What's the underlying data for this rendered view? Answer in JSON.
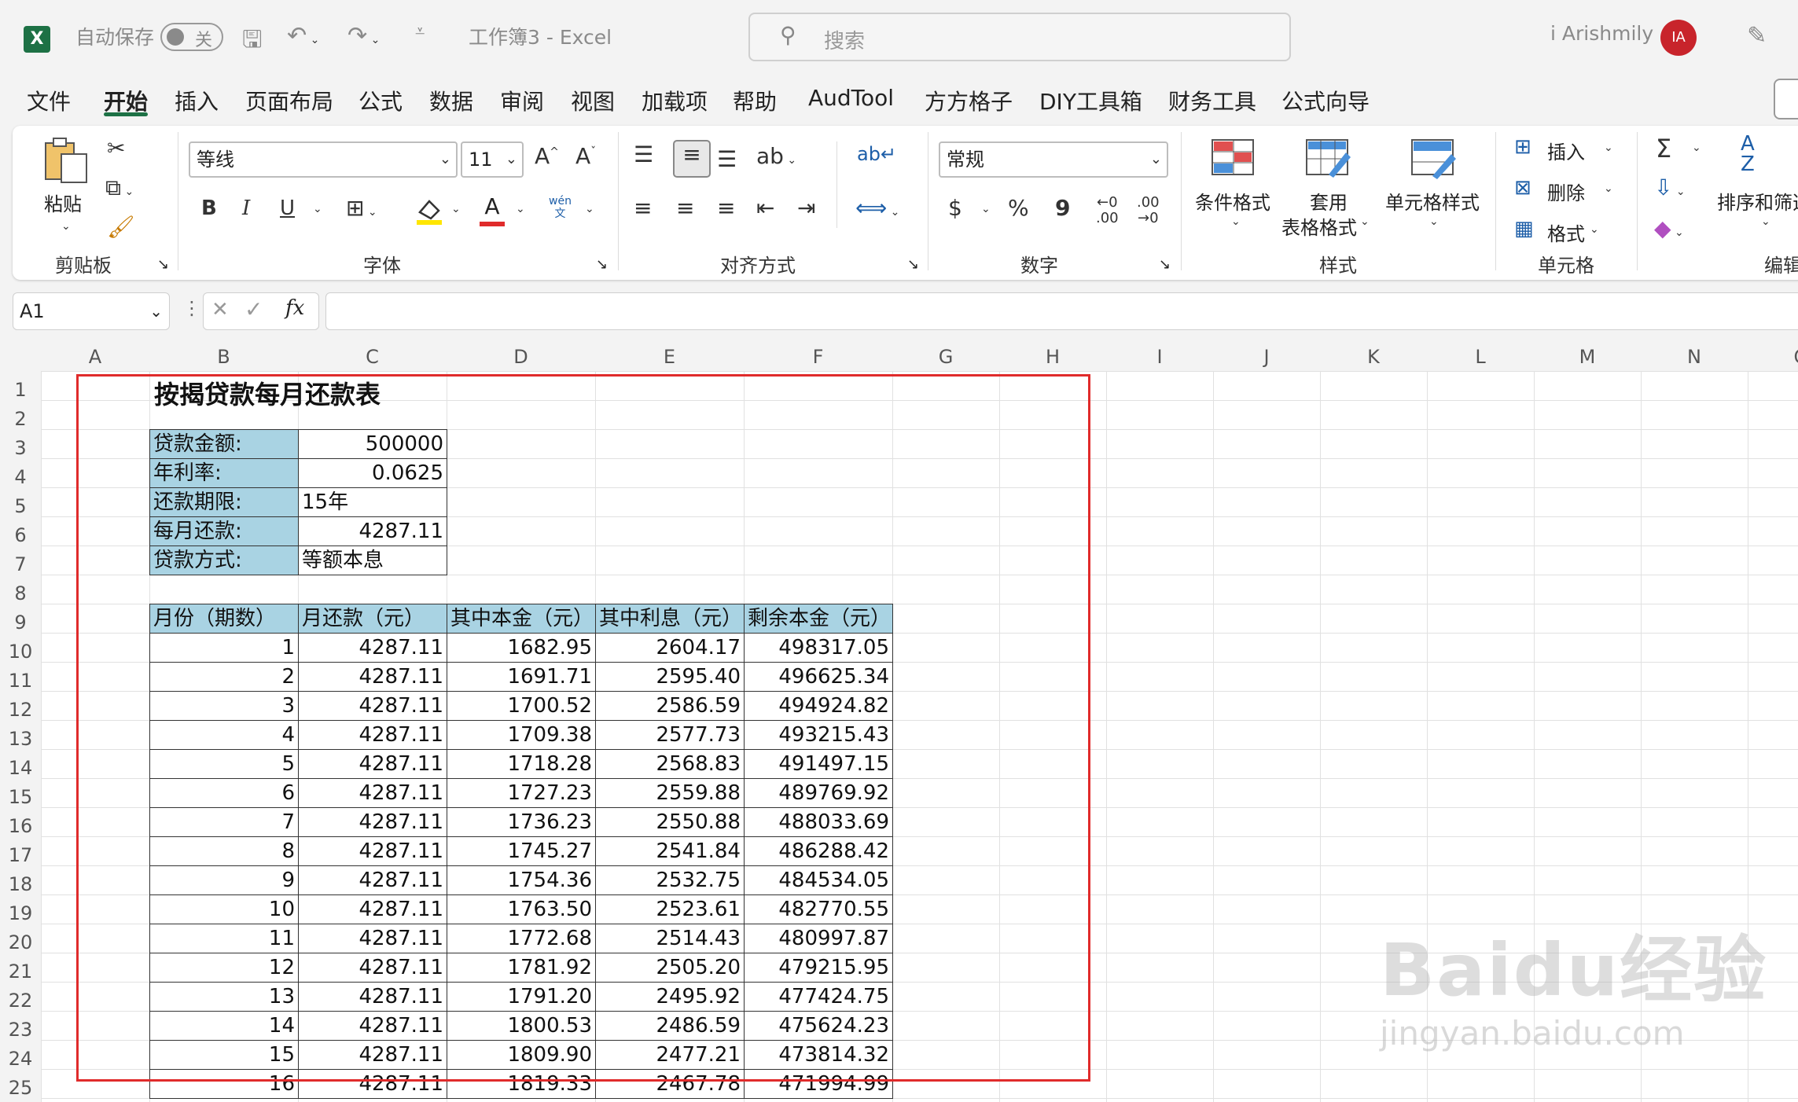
{
  "titlebar": {
    "autosave_label": "自动保存",
    "autosave_state": "关",
    "doc_title": "工作簿3  -  Excel",
    "search_placeholder": "搜索",
    "user_name": "i Arishmily",
    "user_initials": "IA"
  },
  "menu": {
    "tabs": [
      "文件",
      "开始",
      "插入",
      "页面布局",
      "公式",
      "数据",
      "审阅",
      "视图",
      "加载项",
      "帮助",
      "AudTool",
      "方方格子",
      "DIY工具箱",
      "财务工具",
      "公式向导"
    ],
    "active": "开始"
  },
  "ribbon": {
    "clipboard": {
      "paste": "粘贴",
      "group": "剪贴板"
    },
    "font": {
      "name": "等线",
      "size": "11",
      "group": "字体",
      "bold": "B",
      "italic": "I",
      "underline": "U"
    },
    "alignment": {
      "group": "对齐方式"
    },
    "number": {
      "format": "常规",
      "currency": "$",
      "percent": "%",
      "comma": "9",
      "group": "数字"
    },
    "styles": {
      "conditional": "条件格式",
      "table_l1": "套用",
      "table_l2": "表格格式",
      "cell_styles": "单元格样式",
      "group": "样式"
    },
    "cells": {
      "insert": "插入",
      "delete": "删除",
      "format": "格式",
      "group": "单元格"
    },
    "editing": {
      "sum": "Σ",
      "sort": "排序和筛选",
      "group": "编辑"
    }
  },
  "formula_bar": {
    "name_box": "A1",
    "fx": "fx",
    "content": ""
  },
  "columns": [
    "A",
    "B",
    "C",
    "D",
    "E",
    "F",
    "G",
    "H",
    "I",
    "J",
    "K",
    "L",
    "M",
    "N",
    "O"
  ],
  "rows": [
    "1",
    "2",
    "3",
    "4",
    "5",
    "6",
    "7",
    "8",
    "9",
    "10",
    "11",
    "12",
    "13",
    "14",
    "15",
    "16",
    "17",
    "18",
    "19",
    "20",
    "21",
    "22",
    "23",
    "24",
    "25"
  ],
  "sheet": {
    "title": "按揭贷款每月还款表",
    "info": [
      {
        "label": "贷款金额:",
        "value": "500000"
      },
      {
        "label": "年利率:",
        "value": "0.0625"
      },
      {
        "label": "还款期限:",
        "value": "15年"
      },
      {
        "label": "每月还款:",
        "value": "4287.11"
      },
      {
        "label": "贷款方式:",
        "value": "等额本息"
      }
    ],
    "headers": [
      "月份（期数）",
      "月还款（元）",
      "其中本金（元）",
      "其中利息（元）",
      "剩余本金（元）"
    ],
    "table": [
      [
        "1",
        "4287.11",
        "1682.95",
        "2604.17",
        "498317.05"
      ],
      [
        "2",
        "4287.11",
        "1691.71",
        "2595.40",
        "496625.34"
      ],
      [
        "3",
        "4287.11",
        "1700.52",
        "2586.59",
        "494924.82"
      ],
      [
        "4",
        "4287.11",
        "1709.38",
        "2577.73",
        "493215.43"
      ],
      [
        "5",
        "4287.11",
        "1718.28",
        "2568.83",
        "491497.15"
      ],
      [
        "6",
        "4287.11",
        "1727.23",
        "2559.88",
        "489769.92"
      ],
      [
        "7",
        "4287.11",
        "1736.23",
        "2550.88",
        "488033.69"
      ],
      [
        "8",
        "4287.11",
        "1745.27",
        "2541.84",
        "486288.42"
      ],
      [
        "9",
        "4287.11",
        "1754.36",
        "2532.75",
        "484534.05"
      ],
      [
        "10",
        "4287.11",
        "1763.50",
        "2523.61",
        "482770.55"
      ],
      [
        "11",
        "4287.11",
        "1772.68",
        "2514.43",
        "480997.87"
      ],
      [
        "12",
        "4287.11",
        "1781.92",
        "2505.20",
        "479215.95"
      ],
      [
        "13",
        "4287.11",
        "1791.20",
        "2495.92",
        "477424.75"
      ],
      [
        "14",
        "4287.11",
        "1800.53",
        "2486.59",
        "475624.23"
      ],
      [
        "15",
        "4287.11",
        "1809.90",
        "2477.21",
        "473814.32"
      ],
      [
        "16",
        "4287.11",
        "1819.33",
        "2467.78",
        "471994.99"
      ]
    ]
  },
  "watermark": {
    "brand": "Baidu经验",
    "url": "jingyan.baidu.com"
  },
  "colors": {
    "excel_green": "#1d7145",
    "header_blue": "#a9d3e3",
    "highlight_red": "#e02b2b",
    "avatar_red": "#c8242b"
  }
}
